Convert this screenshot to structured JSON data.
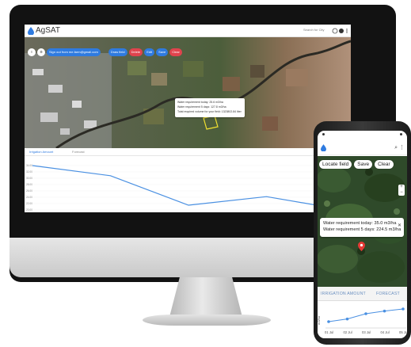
{
  "app": {
    "brand": "AgSAT",
    "search_placeholder": "Search for City"
  },
  "toolbar": {
    "sign_out_label": "Sign out from me.farm@gmail.com",
    "draw_field_label": "Draw field",
    "delete_label": "Delete",
    "edit_label": "Edit",
    "save_label": "Save",
    "clear_label": "Clear"
  },
  "popup": {
    "line1": "Water requirement today: 25.6 m3/ha",
    "line2": "Water requirement 5 days: 127.8 m3/ha",
    "line3": "Total required volume for your field: 1323802.84 liter per day"
  },
  "tabs": {
    "irrigation": "Irrigation Amount",
    "forecast": "Forecast"
  },
  "chart_data": [
    {
      "type": "line",
      "x": [
        "2021-10-18",
        "2021-10-19",
        "2021-10-20",
        "2021-10-21",
        "2021-10-22"
      ],
      "series": [
        {
          "values": [
            34.0,
            30.8,
            21.5,
            24.2,
            20.0
          ]
        }
      ],
      "y_ticks": [
        "34.00",
        "32.00",
        "30.00",
        "28.00",
        "26.00",
        "24.00",
        "22.00",
        "20.00"
      ],
      "ylim": [
        19,
        36
      ],
      "color": "#4a90e2"
    },
    {
      "type": "line",
      "x": [
        "01 Jul",
        "02 Jul",
        "03 Jul",
        "04 Jul",
        "05 Jul"
      ],
      "series": [
        {
          "values": [
            35.0,
            37.5,
            42.5,
            45.0,
            47.0
          ]
        }
      ],
      "ylabel": "m3/ha",
      "color": "#4a90e2"
    }
  ],
  "phone": {
    "locate_label": "Locate field",
    "save_label": "Save",
    "clear_label": "Clear",
    "popup_line1": "Water requirement today: 35.0 m3/ha",
    "popup_line2": "Water requirement 5 days: 224.5 m3/ha",
    "tab_irrigation": "IRRIGATION AMOUNT",
    "tab_forecast": "FORECAST"
  },
  "colors": {
    "accent_blue": "#2f7be0",
    "accent_red": "#e0434d",
    "line": "#4a90e2"
  }
}
